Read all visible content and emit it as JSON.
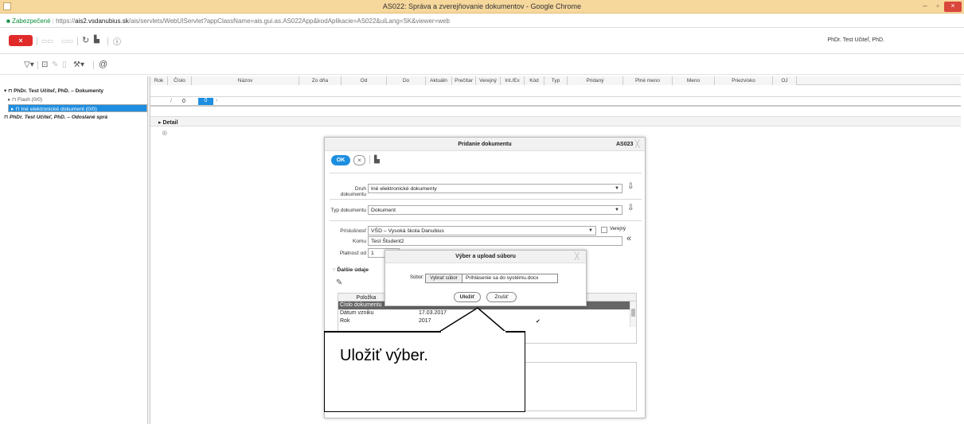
{
  "window": {
    "title": "AS022: Správa a zverejňovanie dokumentov - Google Chrome",
    "controls": [
      "–",
      "▫",
      "×"
    ]
  },
  "address_bar": {
    "security_label": "Zabezpečené",
    "url_scheme": "https://",
    "url_domain": "ais2.vsdanubius.sk",
    "url_path": "/ais/servlets/WebUIServlet?appClassName=ais.gui.as.AS022App&kodAplikacie=AS022&uiLang=SK&viewer=web"
  },
  "app_toolbar": {
    "close_label": "×",
    "user_name": "PhDr. Test Učiteľ, PhD."
  },
  "icons": {
    "close": "close-icon",
    "filter": "filter-icon",
    "new": "new-document-icon",
    "edit": "edit-icon",
    "delete": "delete-icon",
    "tools": "tools-icon",
    "at": "at-icon",
    "refresh": "refresh-icon",
    "chart": "chart-icon",
    "info": "info-icon",
    "lock": "lock-icon"
  },
  "tree": {
    "items": [
      {
        "label": "PhDr. Test Učiteľ, PhD. – Dokumenty",
        "bold": true
      },
      {
        "label": "Flash (0/0)"
      },
      {
        "label": "Iné elektronické dokument (0/0)",
        "selected": true
      },
      {
        "label": "PhDr. Test Učiteľ, PhD. – Odoslané sprá",
        "bold": true,
        "italic": true
      }
    ]
  },
  "grid": {
    "columns": [
      "Rok",
      "Číslo",
      "Názov",
      "Zo dňa",
      "Od",
      "Do",
      "Aktuáln",
      "Prečítar",
      "Verejný",
      "Int./Ex",
      "Kód",
      "Typ",
      "Pridaný",
      "Plné meno",
      "Meno",
      "Priezvisko",
      "OJ"
    ],
    "pager": {
      "prefix": "/",
      "total": "0",
      "current": "0"
    }
  },
  "detail": {
    "label": "Detail"
  },
  "dialog_add": {
    "title": "Pridanie dokumentu",
    "code": "AS023",
    "ok_label": "OK",
    "druh_label": "Druh dokumentu",
    "druh_value": "Iné elektronické dokumenty",
    "typ_label": "Typ dokumentu",
    "typ_value": "Dokument",
    "prislusnost_label": "Príslušnosť",
    "prislusnost_value": "VŠD – Vysoká škola Danubius",
    "verejny_label": "Verejný",
    "komu_label": "Komu",
    "komu_value": "Test Študent2",
    "platnost_label": "Platnosť od",
    "platnost_value": "1",
    "dalsie_label": "Ďalšie údaje",
    "table": {
      "header": "Položka",
      "rows": [
        {
          "key": "Číslo dokumentu",
          "value": "",
          "check": ""
        },
        {
          "key": "Dátum vzniku",
          "value": "17.03.2017",
          "check": ""
        },
        {
          "key": "Rok",
          "value": "2017",
          "check": "✔"
        }
      ]
    }
  },
  "dialog_upload": {
    "title": "Výber a upload súboru",
    "file_label": "Súbor:",
    "choose_label": "Vybrať súbor",
    "file_name": "Prihlásenie sa do systému.docx",
    "save_label": "Uložiť",
    "cancel_label": "Zrušiť"
  },
  "callout": {
    "text": "Uložiť výber."
  }
}
